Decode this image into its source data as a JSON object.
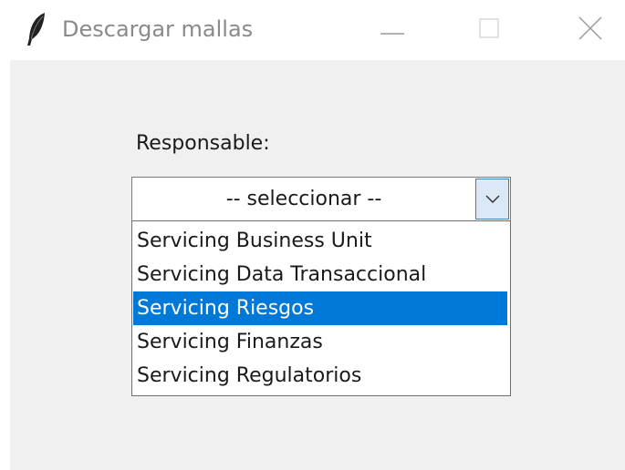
{
  "window": {
    "title": "Descargar mallas",
    "app_icon": "feather-icon",
    "controls": [
      "minimize-icon",
      "maximize-icon",
      "close-icon"
    ]
  },
  "form": {
    "label": "Responsable:",
    "combo": {
      "value": "-- seleccionar --",
      "arrow_icon": "chevron-down-icon"
    },
    "options": [
      {
        "label": "Servicing Business Unit",
        "selected": false
      },
      {
        "label": "Servicing Data Transaccional",
        "selected": false
      },
      {
        "label": "Servicing Riesgos",
        "selected": true
      },
      {
        "label": "Servicing Finanzas",
        "selected": false
      },
      {
        "label": "Servicing Regulatorios",
        "selected": false
      }
    ]
  },
  "colors": {
    "selection": "#0078d7",
    "client_background": "#f0f0f0",
    "arrow_button": "#dbe8f6"
  }
}
